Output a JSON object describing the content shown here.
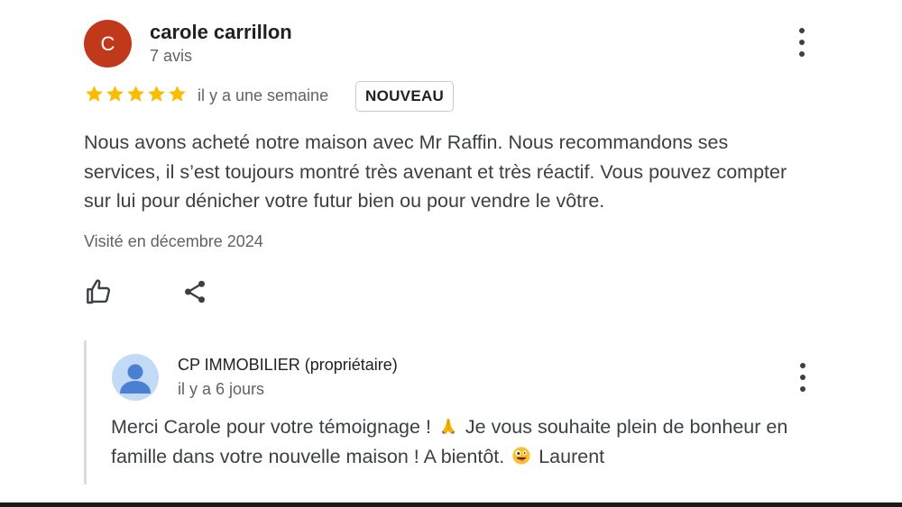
{
  "review": {
    "avatar_letter": "C",
    "author_name": "carole carrillon",
    "author_meta": "7 avis",
    "rating": 5,
    "rating_max": 5,
    "date": "il y a une semaine",
    "badge": "NOUVEAU",
    "text": "Nous avons acheté notre maison avec Mr Raffin. Nous recommandons ses services, il s’est toujours montré très avenant et très réactif. Vous pouvez compter sur lui pour dénicher votre futur bien ou pour vendre le vôtre.",
    "visited": "Visité en décembre 2024"
  },
  "reply": {
    "author": "CP IMMOBILIER (propriétaire)",
    "date": "il y a 6 jours",
    "text_part1": "Merci Carole pour votre témoignage !",
    "text_part2": "Je vous souhaite plein de bonheur en famille dans votre nouvelle maison ! A bientôt.",
    "text_part3": "Laurent"
  },
  "icons": {
    "avatar_color": "#c0391b",
    "star_color": "#fbbc04",
    "reply_avatar_bg": "#c3daf7",
    "reply_avatar_fg": "#4285f4",
    "like": "thumb-up-icon",
    "share": "share-icon",
    "menu": "more-vert-icon",
    "emoji_1": "folded-hands-emoji",
    "emoji_2": "zany-face-emoji"
  }
}
